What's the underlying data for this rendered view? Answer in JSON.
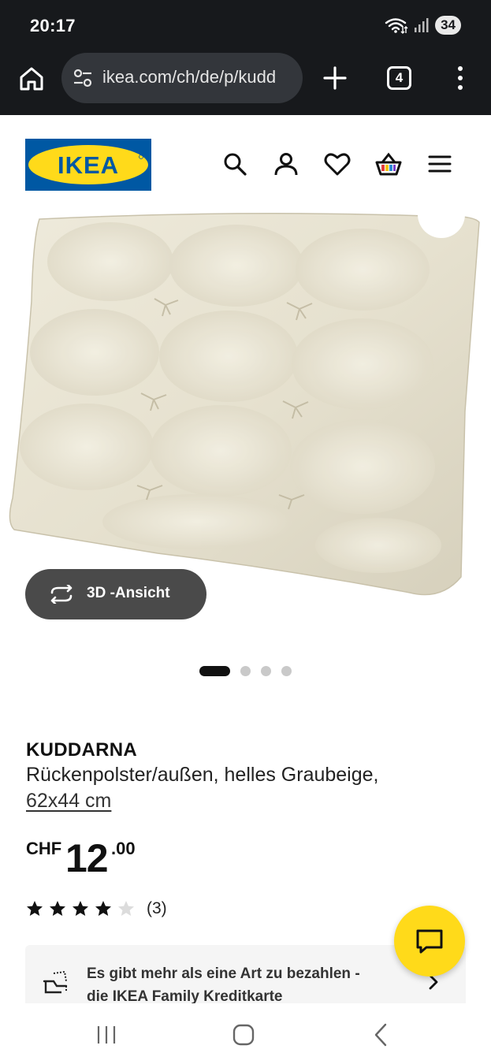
{
  "status_bar": {
    "time": "20:17",
    "battery": "34"
  },
  "browser": {
    "url": "ikea.com/ch/de/p/kudd",
    "tab_count": "4"
  },
  "header": {
    "logo_text": "IKEA",
    "icons": [
      "search-icon",
      "account-icon",
      "wishlist-heart-icon",
      "cart-icon",
      "hamburger-menu-icon"
    ]
  },
  "gallery": {
    "view3d_label": "3D -Ansicht",
    "active_index": 1,
    "total": 4
  },
  "product": {
    "name": "KUDDARNA",
    "description": "Rückenpolster/außen, helles Graubeige,",
    "size": "62x44 cm",
    "price": {
      "currency": "CHF",
      "integer": "12",
      "decimals": ".00"
    },
    "rating": {
      "stars": 4,
      "max": 5,
      "count_label": "(3)"
    }
  },
  "payment_banner": {
    "line1": "Es gibt mehr als eine Art zu bezahlen -",
    "line2": "die IKEA Family Kreditkarte"
  },
  "colors": {
    "ikea_blue": "#0058a3",
    "ikea_yellow": "#ffda1a",
    "chrome_dark": "#17191c",
    "pill": "#33363b"
  }
}
